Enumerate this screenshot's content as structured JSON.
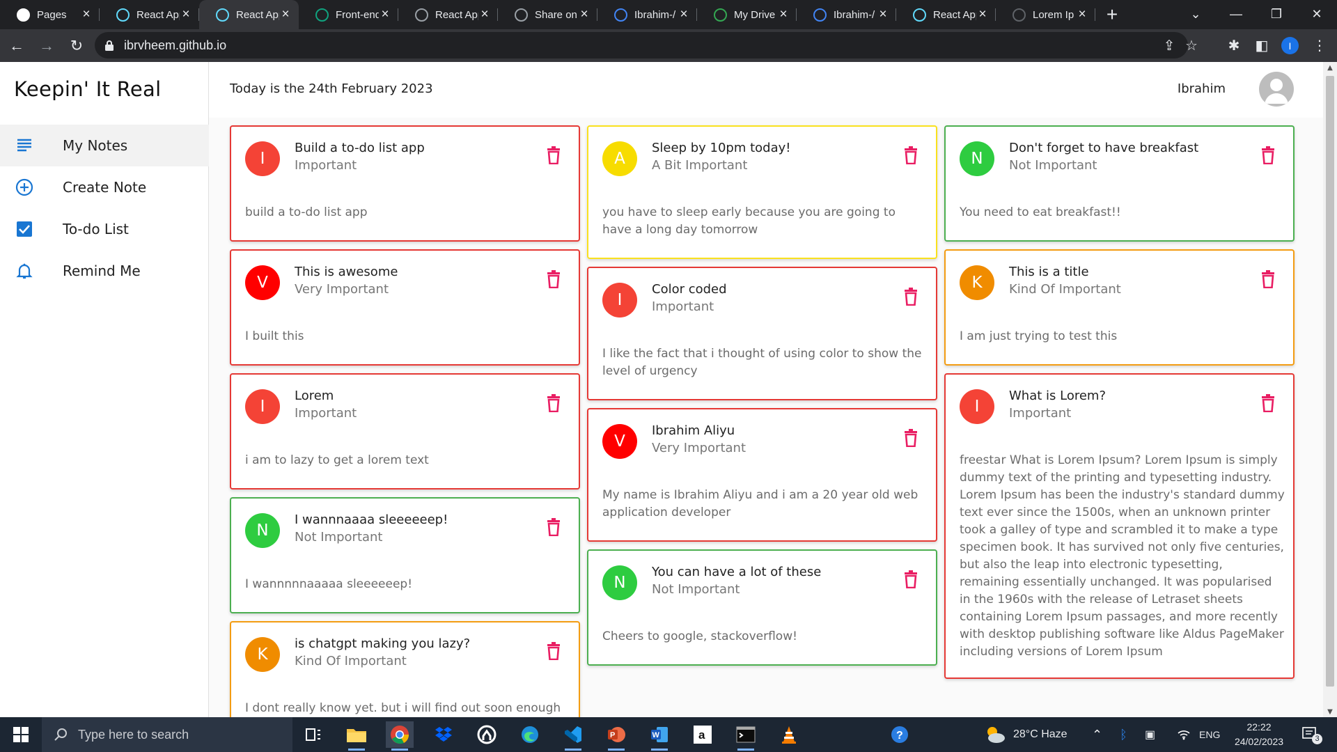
{
  "browser": {
    "tabs": [
      {
        "label": "Pages",
        "icon": "github-icon",
        "active": false
      },
      {
        "label": "React App",
        "icon": "react-icon",
        "active": false
      },
      {
        "label": "React App",
        "icon": "react-icon",
        "active": true
      },
      {
        "label": "Front-end",
        "icon": "openai-icon",
        "active": false
      },
      {
        "label": "React App",
        "icon": "globe-icon",
        "active": false
      },
      {
        "label": "Share on",
        "icon": "globe-icon",
        "active": false
      },
      {
        "label": "Ibrahim-/",
        "icon": "docs-icon",
        "active": false
      },
      {
        "label": "My Drive",
        "icon": "drive-icon",
        "active": false
      },
      {
        "label": "Ibrahim-/",
        "icon": "docs-icon",
        "active": false
      },
      {
        "label": "React App",
        "icon": "react-icon",
        "active": false
      },
      {
        "label": "Lorem Ip",
        "icon": "page-icon",
        "active": false
      }
    ],
    "url": "ibrvheem.github.io",
    "profile_initial": "I"
  },
  "app": {
    "brand": "Keepin' It Real",
    "today": "Today is the 24th February 2023",
    "user_name": "Ibrahim",
    "nav": [
      {
        "label": "My Notes",
        "icon": "notes-list-icon",
        "selected": true
      },
      {
        "label": "Create Note",
        "icon": "add-circle-icon",
        "selected": false
      },
      {
        "label": "To-do List",
        "icon": "checkbox-icon",
        "selected": false
      },
      {
        "label": "Remind Me",
        "icon": "bell-icon",
        "selected": false
      }
    ],
    "notes": [
      {
        "col": 0,
        "initial": "I",
        "title": "Build a to-do list app",
        "urgency": "Important",
        "body": "build a to-do list app",
        "border": "#e53935",
        "avatar": "#f44336"
      },
      {
        "col": 0,
        "initial": "V",
        "title": "This is awesome",
        "urgency": "Very Important",
        "body": "I built this",
        "border": "#e53935",
        "avatar": "#ff0000"
      },
      {
        "col": 0,
        "initial": "I",
        "title": "Lorem",
        "urgency": "Important",
        "body": "i am to lazy to get a lorem text",
        "border": "#e53935",
        "avatar": "#f44336"
      },
      {
        "col": 0,
        "initial": "N",
        "title": "I wannnaaaa sleeeeeep!",
        "urgency": "Not Important",
        "body": "I wannnnnaaaaa sleeeeeep!",
        "border": "#4caf50",
        "avatar": "#2ecc40"
      },
      {
        "col": 0,
        "initial": "K",
        "title": "is chatgpt making you lazy?",
        "urgency": "Kind Of Important",
        "body": "I dont really know yet. but i will find out soon enough",
        "border": "#f39c12",
        "avatar": "#f08c00"
      },
      {
        "col": 1,
        "initial": "A",
        "title": "Sleep by 10pm today!",
        "urgency": "A Bit Important",
        "body": "you have to sleep early because you are going to have a long day tomorrow",
        "border": "#f9e11e",
        "avatar": "#f7dc00"
      },
      {
        "col": 1,
        "initial": "I",
        "title": "Color coded",
        "urgency": "Important",
        "body": "I like the fact that i thought of using color to show the level of urgency",
        "border": "#e53935",
        "avatar": "#f44336"
      },
      {
        "col": 1,
        "initial": "V",
        "title": "Ibrahim Aliyu",
        "urgency": "Very Important",
        "body": "My name is Ibrahim Aliyu and i am a 20 year old web application developer",
        "border": "#e53935",
        "avatar": "#ff0000"
      },
      {
        "col": 1,
        "initial": "N",
        "title": "You can have a lot of these",
        "urgency": "Not Important",
        "body": "Cheers to google, stackoverflow!",
        "border": "#4caf50",
        "avatar": "#2ecc40"
      },
      {
        "col": 2,
        "initial": "N",
        "title": "Don't forget to have breakfast",
        "urgency": "Not Important",
        "body": "You need to eat breakfast!!",
        "border": "#4caf50",
        "avatar": "#2ecc40"
      },
      {
        "col": 2,
        "initial": "K",
        "title": "This is a title",
        "urgency": "Kind Of Important",
        "body": "I am just trying to test this",
        "border": "#f39c12",
        "avatar": "#f08c00"
      },
      {
        "col": 2,
        "initial": "I",
        "title": "What is Lorem?",
        "urgency": "Important",
        "body": "freestar What is Lorem Ipsum? Lorem Ipsum is simply dummy text of the printing and typesetting industry. Lorem Ipsum has been the industry's standard dummy text ever since the 1500s, when an unknown printer took a galley of type and scrambled it to make a type specimen book. It has survived not only five centuries, but also the leap into electronic typesetting, remaining essentially unchanged. It was popularised in the 1960s with the release of Letraset sheets containing Lorem Ipsum passages, and more recently with desktop publishing software like Aldus PageMaker including versions of Lorem Ipsum",
        "border": "#e53935",
        "avatar": "#f44336"
      }
    ]
  },
  "taskbar": {
    "search_placeholder": "Type here to search",
    "weather": "28°C  Haze",
    "language": "ENG",
    "time": "22:22",
    "date": "24/02/2023",
    "notification_count": "3"
  }
}
